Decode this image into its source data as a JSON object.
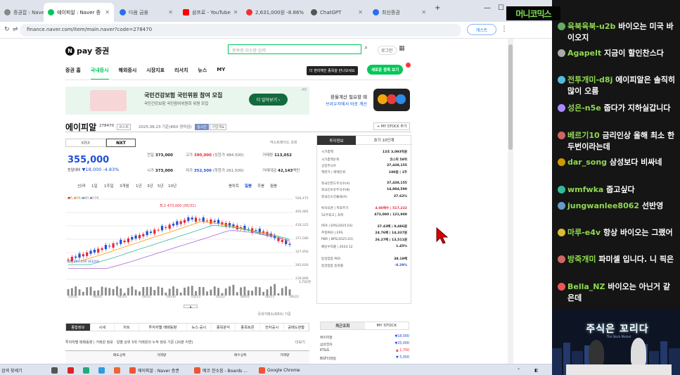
{
  "browser": {
    "tabs": [
      {
        "label": "증권잡 : Naver ...",
        "color": "#888"
      },
      {
        "label": "에이피알 : Naver 증",
        "color": "#03c75a"
      },
      {
        "label": "다음 금융",
        "color": "#2a6ef0"
      },
      {
        "label": "삼프로 - YouTube",
        "color": "#ff0000"
      },
      {
        "label": "2,631,000원 -8.86%",
        "color": "#e33"
      },
      {
        "label": "ChatGPT",
        "color": "#555"
      },
      {
        "label": "최신증권",
        "color": "#2a6ef0"
      }
    ],
    "url": "finance.naver.com/item/main.naver?code=278470",
    "account_label": "게스트"
  },
  "naver": {
    "logo": "pay 증권",
    "search_placeholder": "종목명·지수명 입력",
    "login": "로그인",
    "nav": [
      "증권 홈",
      "국내증시",
      "해외증시",
      "시장지표",
      "리서치",
      "뉴스",
      "MY"
    ],
    "tooltip": "더 편리해진 종목을 만나보세요",
    "new_button": "새로운 종목 보기",
    "ad": {
      "title": "국민건강보험 국민위원 참여 모집",
      "subtitle": "국민건강보험 국민참여위원회 위원 모집",
      "button": "더 알아보기 ›",
      "ad_label": "AD",
      "right_line1": "환율계산 필요할 때",
      "right_line2": "브라우저에서 바로 계산"
    },
    "stock": {
      "name": "에이피알",
      "code": "278470",
      "badge1": "코스피",
      "date": "2025.06.23 기준(KRX 장마감)",
      "badge2": "실시간",
      "badge3": "기업개요",
      "mystock": "+ MY STOCK 추가",
      "tab_krx": "KRX",
      "tab_nxt": "NXT",
      "lbl_search": "넥스트레이드 조회",
      "price": "355,000",
      "change_label": "전일대비",
      "change": "▼18,000",
      "change_pct": "-4.83%",
      "kv": [
        {
          "k": "전일",
          "v": "373,000"
        },
        {
          "k": "고가",
          "v": "390,000",
          "x": "(상한가 484,500)"
        },
        {
          "k": "거래량",
          "v": "113,052"
        },
        {
          "k": "시가",
          "v": "373,000"
        },
        {
          "k": "저가",
          "v": "352,500",
          "x": "(하한가 261,500)"
        },
        {
          "k": "거래대금",
          "v": "42,143",
          "x": "백만"
        }
      ],
      "periods": [
        "선/라",
        "1일",
        "1주일",
        "3개월",
        "1년",
        "3년",
        "5년",
        "10년"
      ],
      "chart_types": [
        "봉차트",
        "일봉",
        "주봉",
        "월봉"
      ],
      "chart_high": "최고 473,000 (05/31)",
      "chart_low": "최저 297,550 (03/24)",
      "legend": [
        "5",
        "20",
        "60",
        "120"
      ]
    },
    "invest": {
      "tab1": "투자정보",
      "tab2": "호가 10단계",
      "rows": [
        {
          "k": "시가총액",
          "v": "13조 3,093억원"
        },
        {
          "k": "시가총액순위",
          "v": "코스피 58위"
        },
        {
          "k": "상장주식수",
          "v": "37,438,155"
        },
        {
          "k": "액면가 | 매매단위",
          "v": "100원 | 1주"
        },
        {
          "k": "외국인한도주식수(A)",
          "v": "37,438,155"
        },
        {
          "k": "외국인보유주식수(B)",
          "v": "14,084,590"
        },
        {
          "k": "외국인소진율(B/A)",
          "v": "37.62%"
        },
        {
          "k": "투자의견 | 목표주가",
          "v": "4.00매수 | 517,222"
        },
        {
          "k": "52주최고 | 최저",
          "v": "473,000 | 121,900"
        },
        {
          "k": "PER | EPS(2025.03)",
          "v": "37.43배 | 9,486원"
        },
        {
          "k": "추정PER | EPS",
          "v": "24.76배 | 14,337원"
        },
        {
          "k": "PBR | BPS(2025.03)",
          "v": "26.27배 | 13,511원"
        },
        {
          "k": "배당수익률 | 2024.12",
          "v": "1.45%"
        },
        {
          "k": "동일업종 PER",
          "v": "38.19배"
        },
        {
          "k": "동일업종 등락률",
          "v": "-0.29%"
        }
      ]
    },
    "foot": "국내거래소(KRX) 기준",
    "tabs2": [
      "종합정보",
      "시세",
      "차트",
      "투자자별 매매동향",
      "뉴스·공시",
      "종목분석",
      "종목토론",
      "전자공시",
      "공매도현황"
    ],
    "sub2": "투자자별 매매동향 | 거래원 정보 · 일별 상위 5위 거래원의 누적 정보 기준 (20분 지연)",
    "sub2_more": "더보기",
    "tbl_header": [
      "매도상위",
      "거래량",
      "매수상위",
      "거래량"
    ],
    "recent_tabs": [
      "최근조회",
      "MY STOCK"
    ],
    "recent": [
      {
        "k": "에이피알",
        "v": "▼18,000"
      },
      {
        "k": "삼성전자",
        "v": "▼25,000"
      },
      {
        "k": "KT&G",
        "v": "▲ 1,700"
      },
      {
        "k": "BGF리테일",
        "v": "▼ 5,000"
      }
    ]
  },
  "taskbar": {
    "search": "검색 찾세기",
    "items": [
      "에이피알 : Naver 증권",
      "에코 한소음 - Boards ...",
      "Google Chrome"
    ]
  },
  "chat": {
    "logo": "머니코믹스",
    "messages": [
      {
        "user": "육북육북-u2b",
        "text": "바이오는 미국 바이오지"
      },
      {
        "user": "Agapelt",
        "text": "지금이 할인찬스다"
      },
      {
        "user": "전투개미-d8j",
        "text": "에이피알은 솔직히 많이 오름"
      },
      {
        "user": "성은-n5e",
        "text": "줍다가 지하실갑니다"
      },
      {
        "user": "베르기10",
        "text": "금리인상 올해 최소 한두번이라는데"
      },
      {
        "user": "dar_song",
        "text": "삼성보다 비싸네"
      },
      {
        "user": "wmfwka",
        "text": "줍고싶다"
      },
      {
        "user": "jungwanlee8062",
        "text": "선반영"
      },
      {
        "user": "마루-e4v",
        "text": "항상 바이오는 그랬어"
      },
      {
        "user": "방죽개미",
        "text": "파미셀 입니다. 니 픽은"
      },
      {
        "user": "Bella_NZ",
        "text": "바이오는 아닌거 같은데"
      }
    ]
  },
  "video": {
    "title": "주식은 꼬리다",
    "subtitle": "The Stock Market"
  },
  "chart_data": {
    "type": "line",
    "x": [
      "03/26",
      "04/01",
      "04/10",
      "04/21",
      "04/30",
      "05/13",
      "05/22",
      "06/01",
      "06/11",
      "06/22"
    ],
    "series": [
      {
        "values": [
          305000,
          330000,
          358000,
          385000,
          412000,
          440000,
          430000,
          410000,
          395000,
          355000
        ]
      }
    ],
    "yticks": [
      "504,475",
      "465,985",
      "418,325",
      "371,586",
      "327,956",
      "283,926",
      "239,896"
    ],
    "ylim": [
      239896,
      504475
    ],
    "volume_max": "1,742천"
  }
}
